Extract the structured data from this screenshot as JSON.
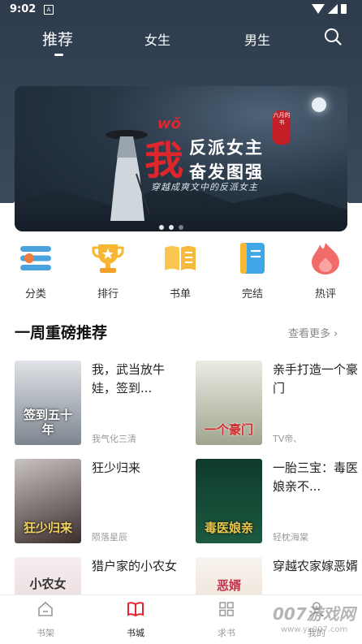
{
  "status": {
    "time": "9:02",
    "sim_label": "A"
  },
  "tabs": [
    {
      "label": "推荐",
      "active": true
    },
    {
      "label": "女生",
      "active": false
    },
    {
      "label": "男生",
      "active": false
    }
  ],
  "banner": {
    "pinyin": "wǒ",
    "big_char": "我",
    "title_line1": "反派女主",
    "title_line2": "奋发图强",
    "subtitle": "穿越成爽文中的反派女主",
    "seal": "六月的书",
    "dots": 3,
    "active_dot": 1
  },
  "shortcuts": [
    {
      "label": "分类",
      "icon": "category-icon"
    },
    {
      "label": "排行",
      "icon": "trophy-icon"
    },
    {
      "label": "书单",
      "icon": "book-list-icon"
    },
    {
      "label": "完结",
      "icon": "completed-book-icon"
    },
    {
      "label": "热评",
      "icon": "hot-comment-icon"
    }
  ],
  "section": {
    "title": "一周重磅推荐",
    "more": "查看更多"
  },
  "books": [
    {
      "title": "我，武当放牛娃，签到...",
      "author": "我气化三清",
      "cover_text": "签到五十年",
      "cover_colors": [
        "#d9dde1",
        "#7d8690"
      ]
    },
    {
      "title": "亲手打造一个豪门",
      "author": "TV帝、",
      "cover_text": "一个豪门",
      "cover_colors": [
        "#e4e8dc",
        "#9fa58f"
      ]
    },
    {
      "title": "狂少归来",
      "author": "陨落星辰",
      "cover_text": "狂少归来",
      "cover_colors": [
        "#b8b2b0",
        "#3b2f2d"
      ]
    },
    {
      "title": "一胎三宝：毒医娘亲不...",
      "author": "轻枕海棠",
      "cover_text": "毒医娘亲",
      "cover_colors": [
        "#0f3a2c",
        "#1c5a40"
      ]
    },
    {
      "title": "猎户家的小农女",
      "author": "",
      "cover_text": "小农女",
      "cover_colors": [
        "#f3e9ea",
        "#e3cfd1"
      ]
    },
    {
      "title": "穿越农家嫁恶婿",
      "author": "",
      "cover_text": "恶婿",
      "cover_colors": [
        "#f6f1ec",
        "#e8d8c8"
      ]
    }
  ],
  "bottom_nav": [
    {
      "label": "书架",
      "active": false
    },
    {
      "label": "书城",
      "active": true
    },
    {
      "label": "求书",
      "active": false
    },
    {
      "label": "我的",
      "active": false
    }
  ],
  "watermark": {
    "line1": "007游戏网",
    "line2": "www.yx007.com"
  },
  "colors": {
    "accent": "#e0262d",
    "header_bg": "#344456"
  }
}
